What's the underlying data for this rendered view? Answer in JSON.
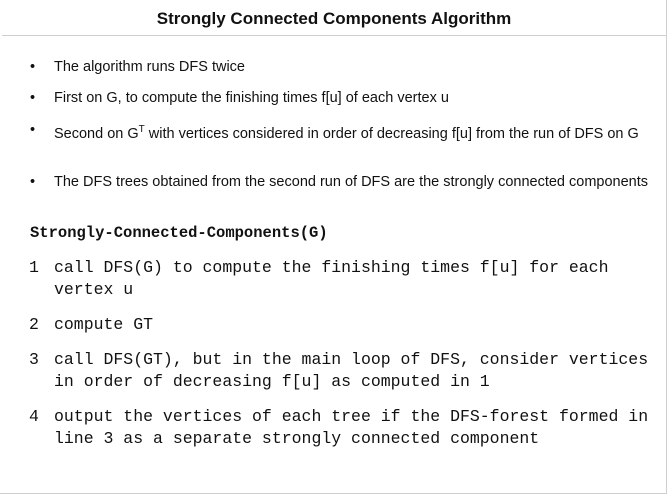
{
  "slide": {
    "title": "Strongly Connected Components Algorithm",
    "bullet_glyph": "•",
    "bullets": [
      "The algorithm runs DFS twice",
      "First on G, to compute the finishing times f[u] of each vertex u",
      {
        "before": "Second on G",
        "sup": "T",
        "after": " with vertices considered in order of decreasing f[u] from the run of DFS on G"
      },
      "The DFS trees obtained from the second run of DFS are the strongly connected components"
    ],
    "procedure_name": "Strongly-Connected-Components(G)",
    "lines": [
      {
        "num": "1",
        "text": "call DFS(G) to compute the finishing times f[u] for each vertex u"
      },
      {
        "num": "2",
        "text": "compute GT"
      },
      {
        "num": "3",
        "text": "call DFS(GT), but in the main loop of DFS, consider vertices in order of decreasing f[u] as computed in 1"
      },
      {
        "num": "4",
        "text": "output the vertices of each tree if the DFS-forest formed in line 3 as a separate strongly connected component"
      }
    ]
  }
}
